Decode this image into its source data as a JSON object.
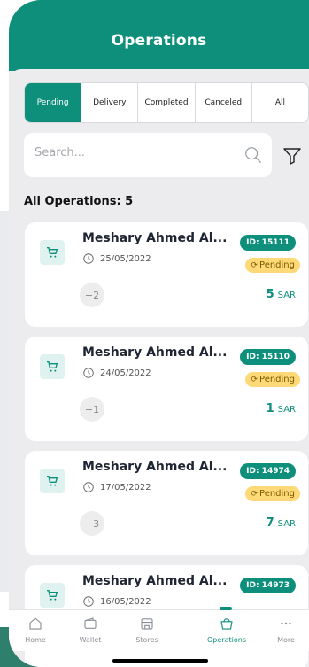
{
  "header": {
    "title": "Operations"
  },
  "tabs": [
    {
      "label": "Pending",
      "active": true
    },
    {
      "label": "Delivery",
      "active": false
    },
    {
      "label": "Completed",
      "active": false
    },
    {
      "label": "Canceled",
      "active": false
    },
    {
      "label": "All",
      "active": false
    }
  ],
  "search": {
    "placeholder": "Search..."
  },
  "list": {
    "count_label": "All Operations: 5"
  },
  "cards": [
    {
      "name": "Meshary Ahmed Al...",
      "date": "25/05/2022",
      "more": "+2",
      "id": "ID: 15111",
      "status": "Pending",
      "amount": "5",
      "currency": "SAR"
    },
    {
      "name": "Meshary Ahmed Al...",
      "date": "24/05/2022",
      "more": "+1",
      "id": "ID: 15110",
      "status": "Pending",
      "amount": "1",
      "currency": "SAR"
    },
    {
      "name": "Meshary Ahmed Al...",
      "date": "17/05/2022",
      "more": "+3",
      "id": "ID: 14974",
      "status": "Pending",
      "amount": "7",
      "currency": "SAR"
    },
    {
      "name": "Meshary Ahmed Al...",
      "date": "16/05/2022",
      "id": "ID: 14973"
    }
  ],
  "nav": [
    {
      "label": "Home",
      "icon": "home-icon"
    },
    {
      "label": "Wallet",
      "icon": "wallet-icon"
    },
    {
      "label": "Stores",
      "icon": "store-icon"
    },
    {
      "label": "Operations",
      "icon": "bag-icon",
      "active": true
    },
    {
      "label": "More",
      "icon": "more-icon"
    }
  ],
  "colors": {
    "brand": "#0e8f7c",
    "pending": "#ffd978",
    "background": "#ececef"
  }
}
